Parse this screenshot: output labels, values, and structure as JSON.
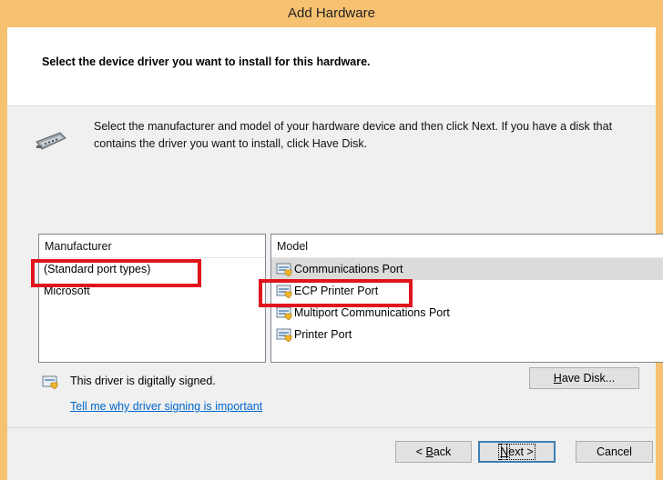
{
  "window": {
    "title": "Add Hardware"
  },
  "header": {
    "title": "Select the device driver you want to install for this hardware."
  },
  "intro": {
    "text": "Select the manufacturer and model of your hardware device and then click Next. If you have a disk that contains the driver you want to install, click Have Disk."
  },
  "manufacturer_list": {
    "header": "Manufacturer",
    "items": [
      "(Standard port types)",
      "Microsoft"
    ]
  },
  "model_list": {
    "header": "Model",
    "items": [
      "Communications Port",
      "ECP Printer Port",
      "Multiport Communications Port",
      "Printer Port"
    ]
  },
  "signing": {
    "status": "This driver is digitally signed.",
    "link": "Tell me why driver signing is important"
  },
  "buttons": {
    "have_disk": {
      "prefix": "",
      "accel": "H",
      "rest": "ave Disk..."
    },
    "back": {
      "prefix": "< ",
      "accel": "B",
      "rest": "ack"
    },
    "next": {
      "prefix": "",
      "accel": "N",
      "rest": "ext >"
    },
    "cancel": "Cancel"
  },
  "colors": {
    "title_bar": "#f6c170",
    "highlight_box": "#e0141d",
    "link": "#0066cc"
  }
}
